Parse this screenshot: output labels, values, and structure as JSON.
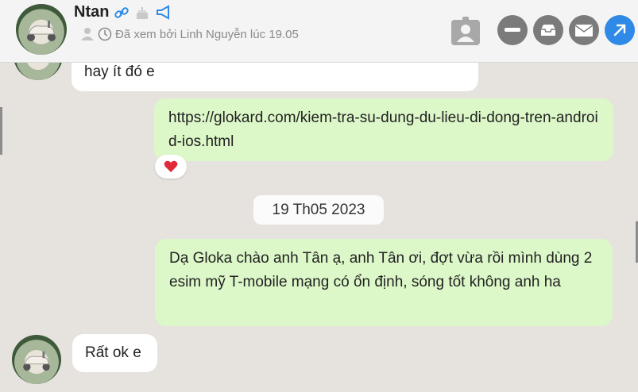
{
  "header": {
    "contact_name": "Ntan",
    "seen_status": "Đã xem bởi Linh Nguyễn lúc 19.05"
  },
  "messages": [
    {
      "direction": "in",
      "text": "hay ít đó e"
    },
    {
      "direction": "out",
      "text": "https://glokard.com/kiem-tra-su-dung-du-lieu-di-dong-tren-android-ios.html",
      "reaction": "heart"
    },
    {
      "direction": "out",
      "text": "Dạ Gloka chào anh Tân ạ, anh Tân ơi, đợt vừa rồi mình dùng 2 esim mỹ T-mobile mạng có ổn định, sóng tốt không anh ha"
    },
    {
      "direction": "in",
      "text": "Rất ok e"
    }
  ],
  "date_separator": "19 Th05 2023",
  "colors": {
    "outgoing_bubble": "#dcf7c8",
    "incoming_bubble": "#ffffff",
    "chat_background": "#e6e2de",
    "accent_blue": "#2e8ae6",
    "reaction_heart": "#e02a3a"
  },
  "icons": [
    "link-icon",
    "birthday-cake-icon",
    "megaphone-icon",
    "user-icon",
    "clock-icon",
    "contact-card-icon",
    "minimize-icon",
    "archive-icon",
    "email-icon",
    "open-external-icon",
    "heart-reaction-icon"
  ]
}
